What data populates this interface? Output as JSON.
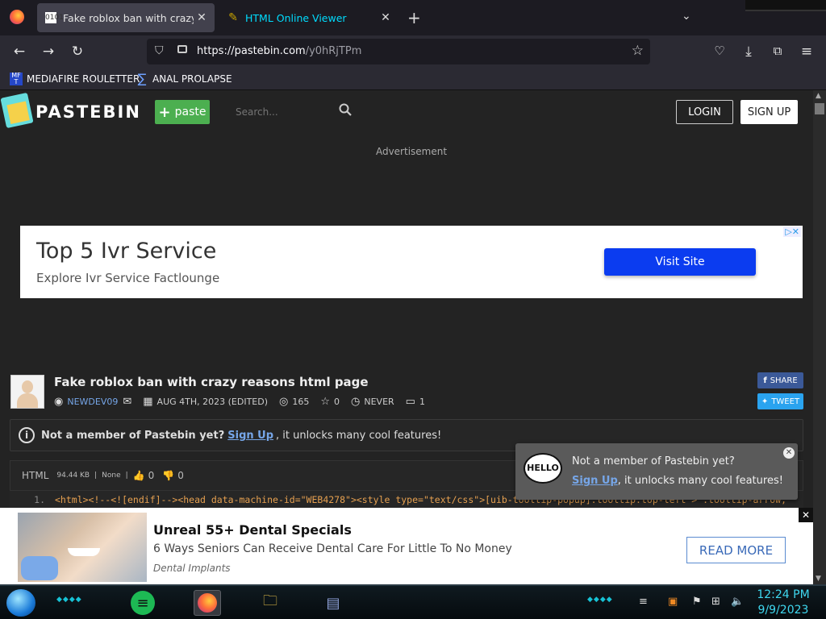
{
  "browser": {
    "tabs": [
      {
        "title": "Fake roblox ban with crazy reas",
        "favicon": "0101",
        "active": true
      },
      {
        "title": "HTML Online Viewer",
        "favicon": "✎",
        "active": false
      }
    ],
    "new_tab": "+",
    "tab_list": "⌄",
    "close_glyph": "✕",
    "url_host": "https://pastebin.com",
    "url_path": "/y0hRjTPm",
    "bookmarks": [
      {
        "label": "MEDIAFIRE ROULETTER",
        "icon": "MF T"
      },
      {
        "label": "ANAL PROLAPSE",
        "icon": "∑"
      }
    ]
  },
  "pastebin": {
    "brand": "PASTEBIN",
    "paste_button": "paste",
    "search_placeholder": "Search...",
    "login": "LOGIN",
    "signup": "SIGN UP",
    "ad_label": "Advertisement"
  },
  "top_ad": {
    "title": "Top 5 Ivr Service",
    "subtitle": "Explore Ivr Service Factlounge",
    "cta": "Visit Site",
    "badge": "▷✕"
  },
  "paste": {
    "title": "Fake roblox ban with crazy reasons html page",
    "author": "NEWDEV09",
    "date": "AUG 4TH, 2023 (EDITED)",
    "views": "165",
    "stars": "0",
    "expires": "NEVER",
    "comments": "1",
    "share": "SHARE",
    "tweet": "TWEET"
  },
  "notice": {
    "bold": "Not a member of Pastebin yet?",
    "link": "Sign Up",
    "rest": ", it unlocks many cool features!"
  },
  "code_bar": {
    "language": "HTML",
    "size": "94.44 KB",
    "category": "None",
    "likes": "0",
    "dislikes": "0"
  },
  "code": {
    "line_no": "1.",
    "line": "<html><!--<![endif]--><head data-machine-id=\"WEB4278\"><style type=\"text/css\">[uib-tooltip-popup].tooltip.top-left > .tooltip-arrow,"
  },
  "toast": {
    "hello": "HELLO",
    "line1": "Not a member of Pastebin yet?",
    "link": "Sign Up",
    "rest": ", it unlocks many cool features!"
  },
  "bottom_ad": {
    "title": "Unreal 55+ Dental Specials",
    "subtitle": "6 Ways Seniors Can Receive Dental Care For Little To No Money",
    "source": "Dental Implants",
    "cta": "READ MORE"
  },
  "taskbar": {
    "time": "12:24 PM",
    "date": "9/9/2023"
  }
}
